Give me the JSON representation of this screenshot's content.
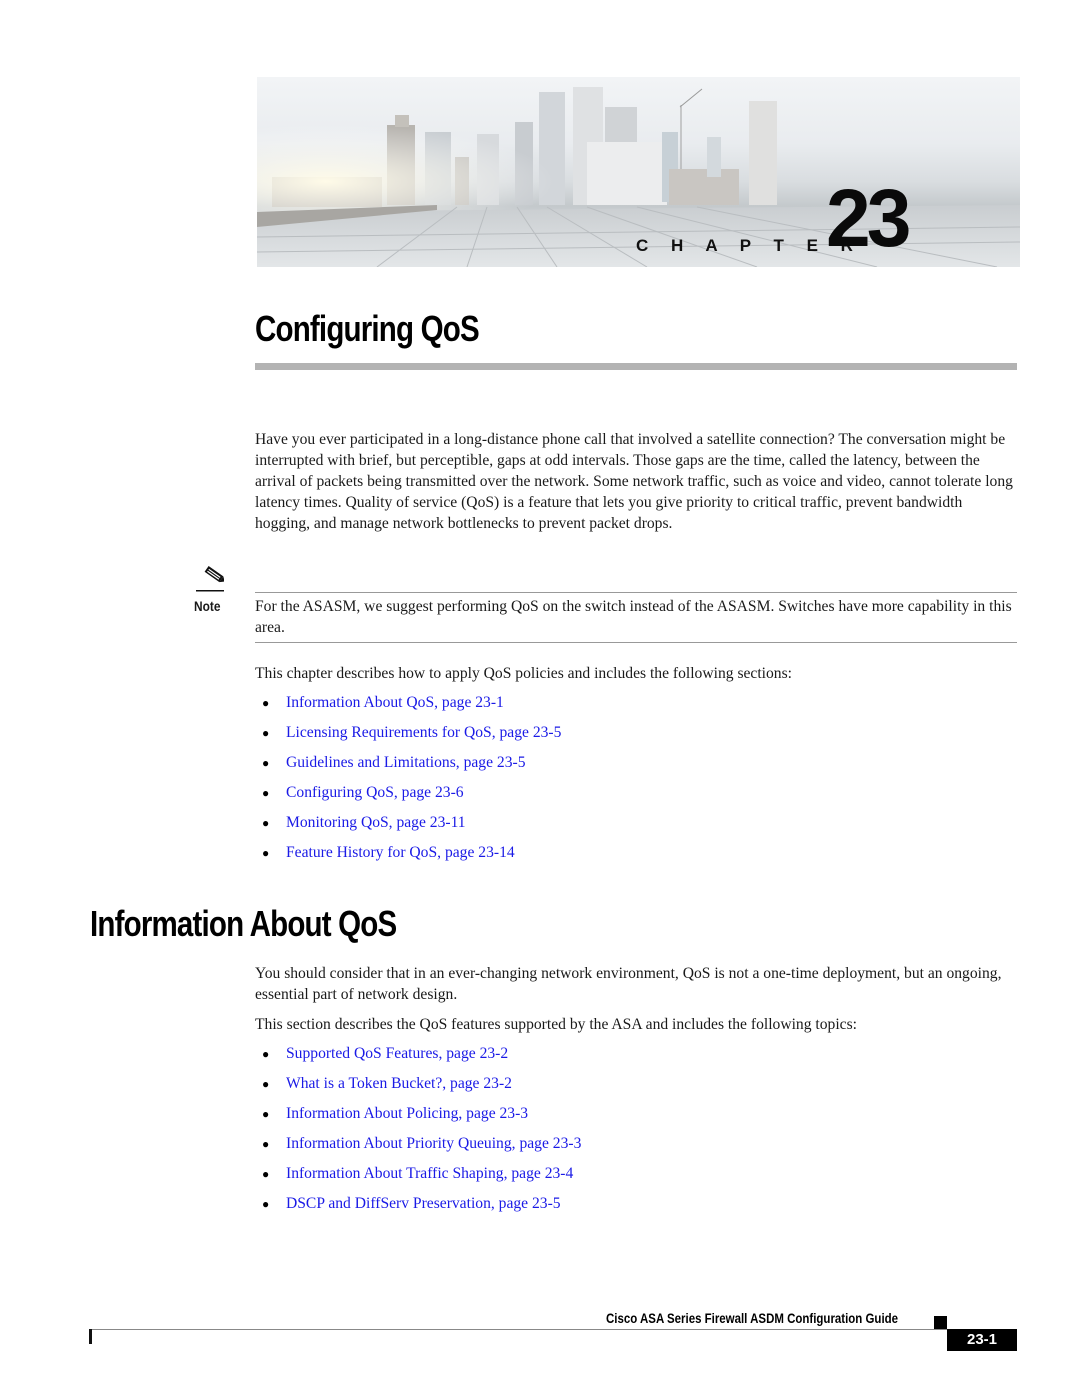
{
  "banner": {
    "image": "city-skyline-chapter-banner",
    "chapter_word": "C H A P T E R",
    "chapter_number": "23"
  },
  "chapter_title": "Configuring QoS",
  "intro_paragraph": "Have you ever participated in a long-distance phone call that involved a satellite connection? The conversation might be interrupted with brief, but perceptible, gaps at odd intervals. Those gaps are the time, called the latency, between the arrival of packets being transmitted over the network. Some network traffic, such as voice and video, cannot tolerate long latency times. Quality of service (QoS) is a feature that lets you give priority to critical traffic, prevent bandwidth hogging, and manage network bottlenecks to prevent packet drops.",
  "note": {
    "icon": "pencil-note-icon",
    "label": "Note",
    "text": "For the ASASM, we suggest performing QoS on the switch instead of the ASASM. Switches have more capability in this area."
  },
  "sections_intro": "This chapter describes how to apply QoS policies and includes the following sections:",
  "sections": [
    {
      "label": "Information About QoS, page 23-1"
    },
    {
      "label": "Licensing Requirements for QoS, page 23-5"
    },
    {
      "label": "Guidelines and Limitations, page 23-5"
    },
    {
      "label": "Configuring QoS, page 23-6"
    },
    {
      "label": "Monitoring QoS, page 23-11"
    },
    {
      "label": "Feature History for QoS, page 23-14"
    }
  ],
  "info_heading": "Information About QoS",
  "info_paragraph_1": "You should consider that in an ever-changing network environment, QoS is not a one-time deployment, but an ongoing, essential part of network design.",
  "info_paragraph_2": "This section describes the QoS features supported by the ASA and includes the following topics:",
  "topics": [
    {
      "label": "Supported QoS Features, page 23-2"
    },
    {
      "label": "What is a Token Bucket?, page 23-2"
    },
    {
      "label": "Information About Policing, page 23-3"
    },
    {
      "label": "Information About Priority Queuing, page 23-3"
    },
    {
      "label": "Information About Traffic Shaping, page 23-4"
    },
    {
      "label": "DSCP and DiffServ Preservation, page 23-5"
    }
  ],
  "footer": {
    "guide_title": "Cisco ASA Series Firewall ASDM Configuration Guide",
    "page_number": "23-1"
  },
  "colors": {
    "link": "#1a1ae6",
    "title_bar": "#b3b3b3"
  }
}
